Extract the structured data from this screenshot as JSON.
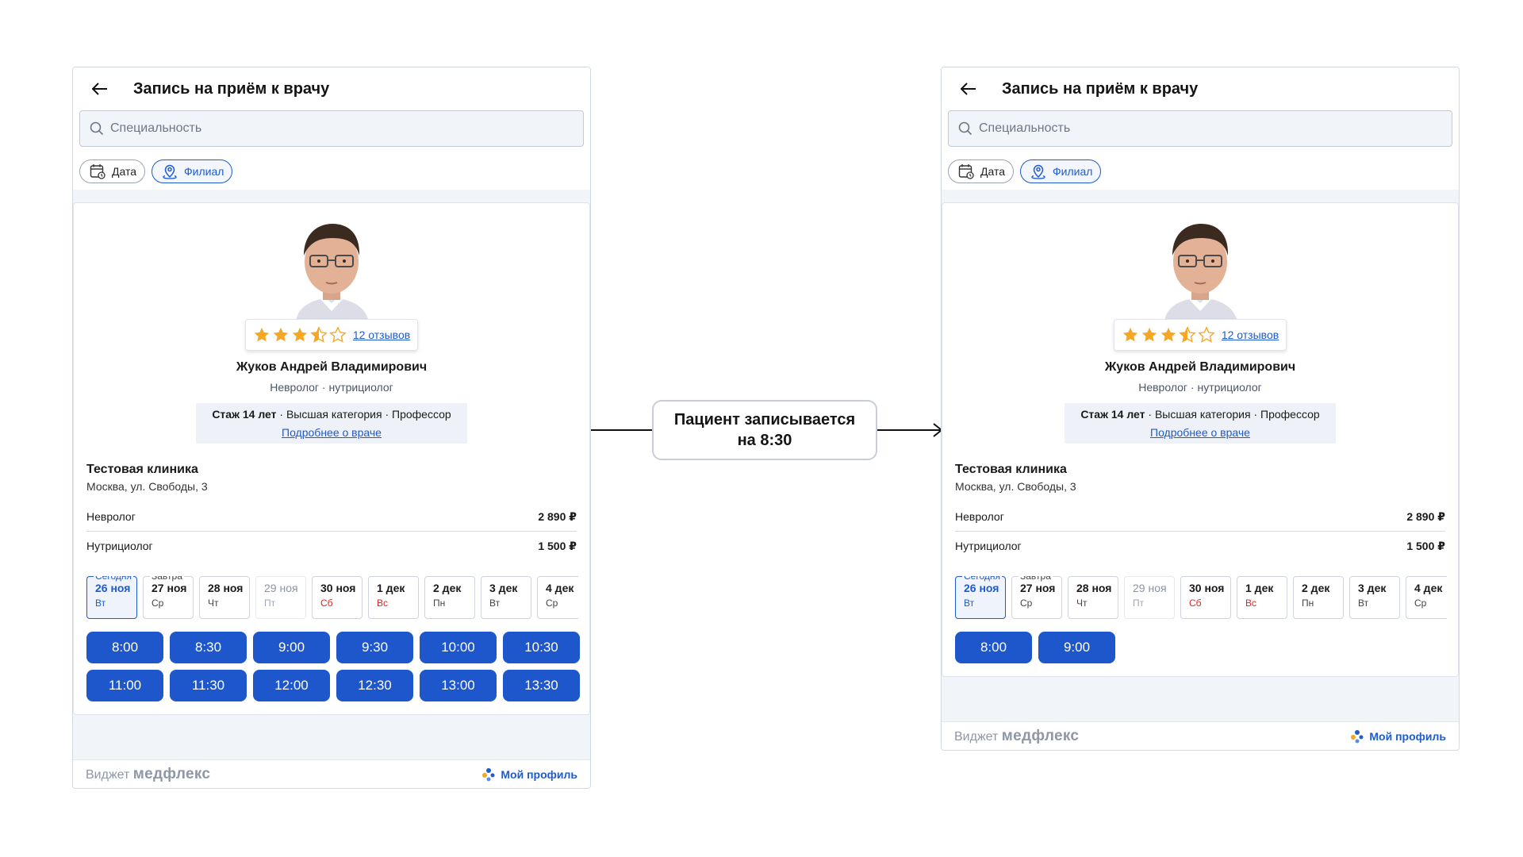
{
  "callout": {
    "line1": "Пациент записывается",
    "line2": "на 8:30"
  },
  "widget": {
    "title": "Запись на приём к врачу",
    "search_placeholder": "Специальность",
    "filters": {
      "date": "Дата",
      "branch": "Филиал"
    },
    "doctor": {
      "rating": 3.5,
      "reviews": "12 отзывов",
      "name": "Жуков Андрей Владимирович",
      "specialty": "Невролог · нутрициолог",
      "experience_bold": "Стаж 14 лет",
      "experience_rest": " · Высшая категория · Профессор",
      "more_link": "Подробнее о враче"
    },
    "clinic": {
      "name": "Тестовая клиника",
      "address": "Москва, ул. Свободы, 3"
    },
    "services": [
      {
        "name": "Невролог",
        "price": "2 890 ₽"
      },
      {
        "name": "Нутрициолог",
        "price": "1 500 ₽"
      }
    ],
    "dates": [
      {
        "tag": "Сегодня",
        "date": "26 ноя",
        "weekday": "Вт",
        "state": "selected"
      },
      {
        "tag": "Завтра",
        "date": "27 ноя",
        "weekday": "Ср",
        "state": "normal"
      },
      {
        "tag": "",
        "date": "28 ноя",
        "weekday": "Чт",
        "state": "normal"
      },
      {
        "tag": "",
        "date": "29 ноя",
        "weekday": "Пт",
        "state": "disabled"
      },
      {
        "tag": "",
        "date": "30 ноя",
        "weekday": "Сб",
        "state": "weekend"
      },
      {
        "tag": "",
        "date": "1 дек",
        "weekday": "Вс",
        "state": "weekend"
      },
      {
        "tag": "",
        "date": "2 дек",
        "weekday": "Пн",
        "state": "normal"
      },
      {
        "tag": "",
        "date": "3 дек",
        "weekday": "Вт",
        "state": "normal"
      },
      {
        "tag": "",
        "date": "4 дек",
        "weekday": "Ср",
        "state": "normal"
      }
    ],
    "footer": {
      "label": "Виджет",
      "brand": "медфлекс",
      "profile": "Мой профиль"
    }
  },
  "slots_before": [
    "8:00",
    "8:30",
    "9:00",
    "9:30",
    "10:00",
    "10:30",
    "11:00",
    "11:30",
    "12:00",
    "12:30",
    "13:00",
    "13:30"
  ],
  "slots_after": [
    "8:00",
    "9:00"
  ],
  "colors": {
    "accent": "#1e57cc",
    "star": "#f5a623",
    "weekend": "#d42828"
  }
}
